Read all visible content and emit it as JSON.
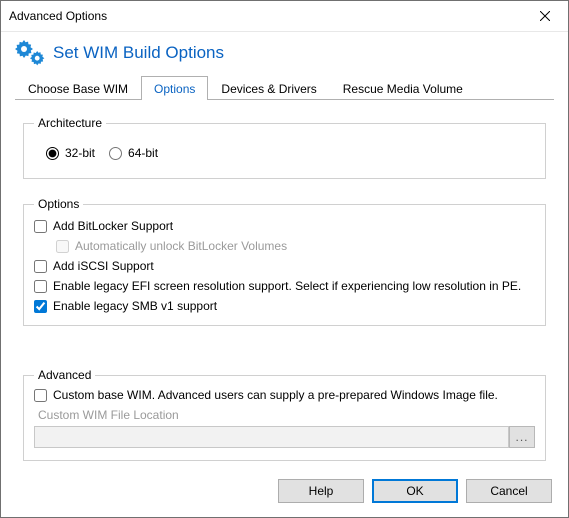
{
  "window_title": "Advanced Options",
  "header_title": "Set WIM Build Options",
  "tabs": {
    "base": "Choose Base WIM",
    "options": "Options",
    "devices": "Devices & Drivers",
    "rescue": "Rescue Media Volume"
  },
  "arch": {
    "legend": "Architecture",
    "r32": "32-bit",
    "r64": "64-bit"
  },
  "opts": {
    "legend": "Options",
    "bitlocker": "Add BitLocker Support",
    "bitlocker_auto": "Automatically unlock BitLocker Volumes",
    "iscsi": "Add iSCSI Support",
    "efi": "Enable legacy EFI screen resolution support.  Select if experiencing low resolution in PE.",
    "smb": "Enable legacy SMB v1 support"
  },
  "adv": {
    "legend": "Advanced",
    "custom": "Custom base WIM. Advanced users can supply a pre-prepared Windows Image file.",
    "loc_label": "Custom WIM File Location",
    "browse": "..."
  },
  "buttons": {
    "help": "Help",
    "ok": "OK",
    "cancel": "Cancel"
  }
}
